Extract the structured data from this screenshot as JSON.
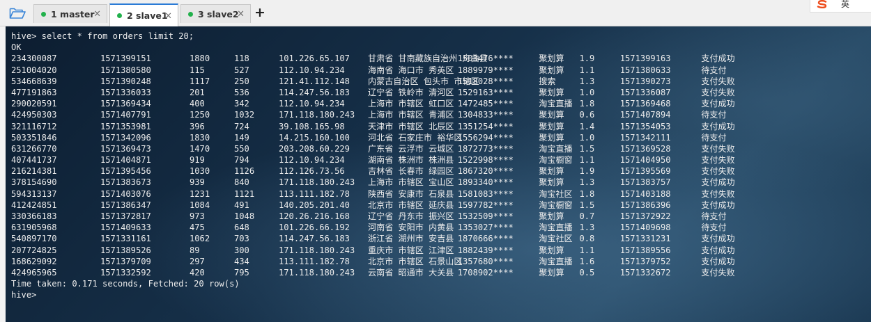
{
  "tabs": [
    {
      "label": "1 master"
    },
    {
      "label": "2 slave1"
    },
    {
      "label": "3 slave2"
    }
  ],
  "tab_close_glyph": "×",
  "add_tab_glyph": "+",
  "ime_text": "英",
  "terminal": {
    "command": "hive> select * from orders limit 20;",
    "ok": "OK",
    "rows": [
      [
        "234300087",
        "1571399151",
        "1880",
        "118",
        "101.226.65.107",
        "甘肃省 甘南藏族自治州 舟曲县",
        "1503476****",
        "聚划算",
        "1.9",
        "1571399163",
        "支付成功"
      ],
      [
        "251004020",
        "1571380580",
        "115",
        "527",
        "112.10.94.234",
        "海南省 海口市 秀英区",
        "1889979****",
        "聚划算",
        "1.1",
        "1571380633",
        "待支付"
      ],
      [
        "534668639",
        "1571390248",
        "1117",
        "250",
        "121.41.112.148",
        "内蒙古自治区 包头市 市辖区",
        "1518028****",
        "搜索",
        "1.3",
        "1571390273",
        "支付失败"
      ],
      [
        "477191863",
        "1571336033",
        "201",
        "536",
        "114.247.56.183",
        "辽宁省 铁岭市 清河区",
        "1529163****",
        "聚划算",
        "1.0",
        "1571336087",
        "支付失败"
      ],
      [
        "290020591",
        "1571369434",
        "400",
        "342",
        "112.10.94.234",
        "上海市 市辖区 虹口区",
        "1472485****",
        "淘宝直播",
        "1.8",
        "1571369468",
        "支付成功"
      ],
      [
        "424950303",
        "1571407791",
        "1250",
        "1032",
        "171.118.180.243",
        "上海市 市辖区 青浦区",
        "1304833****",
        "聚划算",
        "0.6",
        "1571407894",
        "待支付"
      ],
      [
        "321116712",
        "1571353981",
        "396",
        "724",
        "39.108.165.98",
        "天津市 市辖区 北辰区",
        "1351254****",
        "聚划算",
        "1.4",
        "1571354053",
        "支付成功"
      ],
      [
        "503351846",
        "1571342096",
        "1830",
        "149",
        "14.215.160.100",
        "河北省 石家庄市 裕华区",
        "1556294****",
        "聚划算",
        "1.0",
        "1571342111",
        "待支付"
      ],
      [
        "631266770",
        "1571369473",
        "1470",
        "550",
        "203.208.60.229",
        "广东省 云浮市 云城区",
        "1872773****",
        "淘宝直播",
        "1.5",
        "1571369528",
        "支付失败"
      ],
      [
        "407441737",
        "1571404871",
        "919",
        "794",
        "112.10.94.234",
        "湖南省 株洲市 株洲县",
        "1522998****",
        "淘宝橱窗",
        "1.1",
        "1571404950",
        "支付失败"
      ],
      [
        "216214381",
        "1571395456",
        "1030",
        "1126",
        "112.126.73.56",
        "吉林省 长春市 绿园区",
        "1867320****",
        "聚划算",
        "1.9",
        "1571395569",
        "支付失败"
      ],
      [
        "378154690",
        "1571383673",
        "939",
        "840",
        "171.118.180.243",
        "上海市 市辖区 宝山区",
        "1893340****",
        "聚划算",
        "1.3",
        "1571383757",
        "支付成功"
      ],
      [
        "594313137",
        "1571403076",
        "1231",
        "1121",
        "113.111.182.78",
        "陕西省 安康市 石泉县",
        "1581083****",
        "淘宝社区",
        "1.8",
        "1571403188",
        "支付失败"
      ],
      [
        "412424851",
        "1571386347",
        "1084",
        "491",
        "140.205.201.40",
        "北京市 市辖区 延庆县",
        "1597782****",
        "淘宝橱窗",
        "1.5",
        "1571386396",
        "支付成功"
      ],
      [
        "330366183",
        "1571372817",
        "973",
        "1048",
        "120.26.216.168",
        "辽宁省 丹东市 振兴区",
        "1532509****",
        "聚划算",
        "0.7",
        "1571372922",
        "待支付"
      ],
      [
        "631905968",
        "1571409633",
        "475",
        "648",
        "101.226.66.192",
        "河南省 安阳市 内黄县",
        "1353027****",
        "淘宝直播",
        "1.3",
        "1571409698",
        "待支付"
      ],
      [
        "540897170",
        "1571331161",
        "1062",
        "703",
        "114.247.56.183",
        "浙江省 湖州市 安吉县",
        "1870666****",
        "淘宝社区",
        "0.8",
        "1571331231",
        "支付成功"
      ],
      [
        "207724825",
        "1571389526",
        "89",
        "300",
        "171.118.180.243",
        "重庆市 市辖区 江津区",
        "1882439****",
        "聚划算",
        "1.1",
        "1571389556",
        "支付成功"
      ],
      [
        "168629092",
        "1571379709",
        "297",
        "434",
        "113.111.182.78",
        "北京市 市辖区 石景山区",
        "1357680****",
        "淘宝直播",
        "1.6",
        "1571379752",
        "支付成功"
      ],
      [
        "424965965",
        "1571332592",
        "420",
        "795",
        "171.118.180.243",
        "云南省 昭通市 大关县",
        "1708902****",
        "聚划算",
        "0.5",
        "1571332672",
        "支付失败"
      ]
    ],
    "footer": "Time taken: 0.171 seconds, Fetched: 20 row(s)",
    "prompt": "hive>"
  },
  "colors": {
    "terminal_bg": "#163049",
    "terminal_text": "#ececec",
    "active_tab_accent": "#2b7bd6",
    "status_dot": "#22b14c"
  },
  "icons": {
    "open_folder": "folder-open-icon",
    "tab_status": "status-dot-icon",
    "tab_close": "close-icon",
    "add_tab": "plus-icon",
    "ime": "sogou-ime-icon"
  }
}
